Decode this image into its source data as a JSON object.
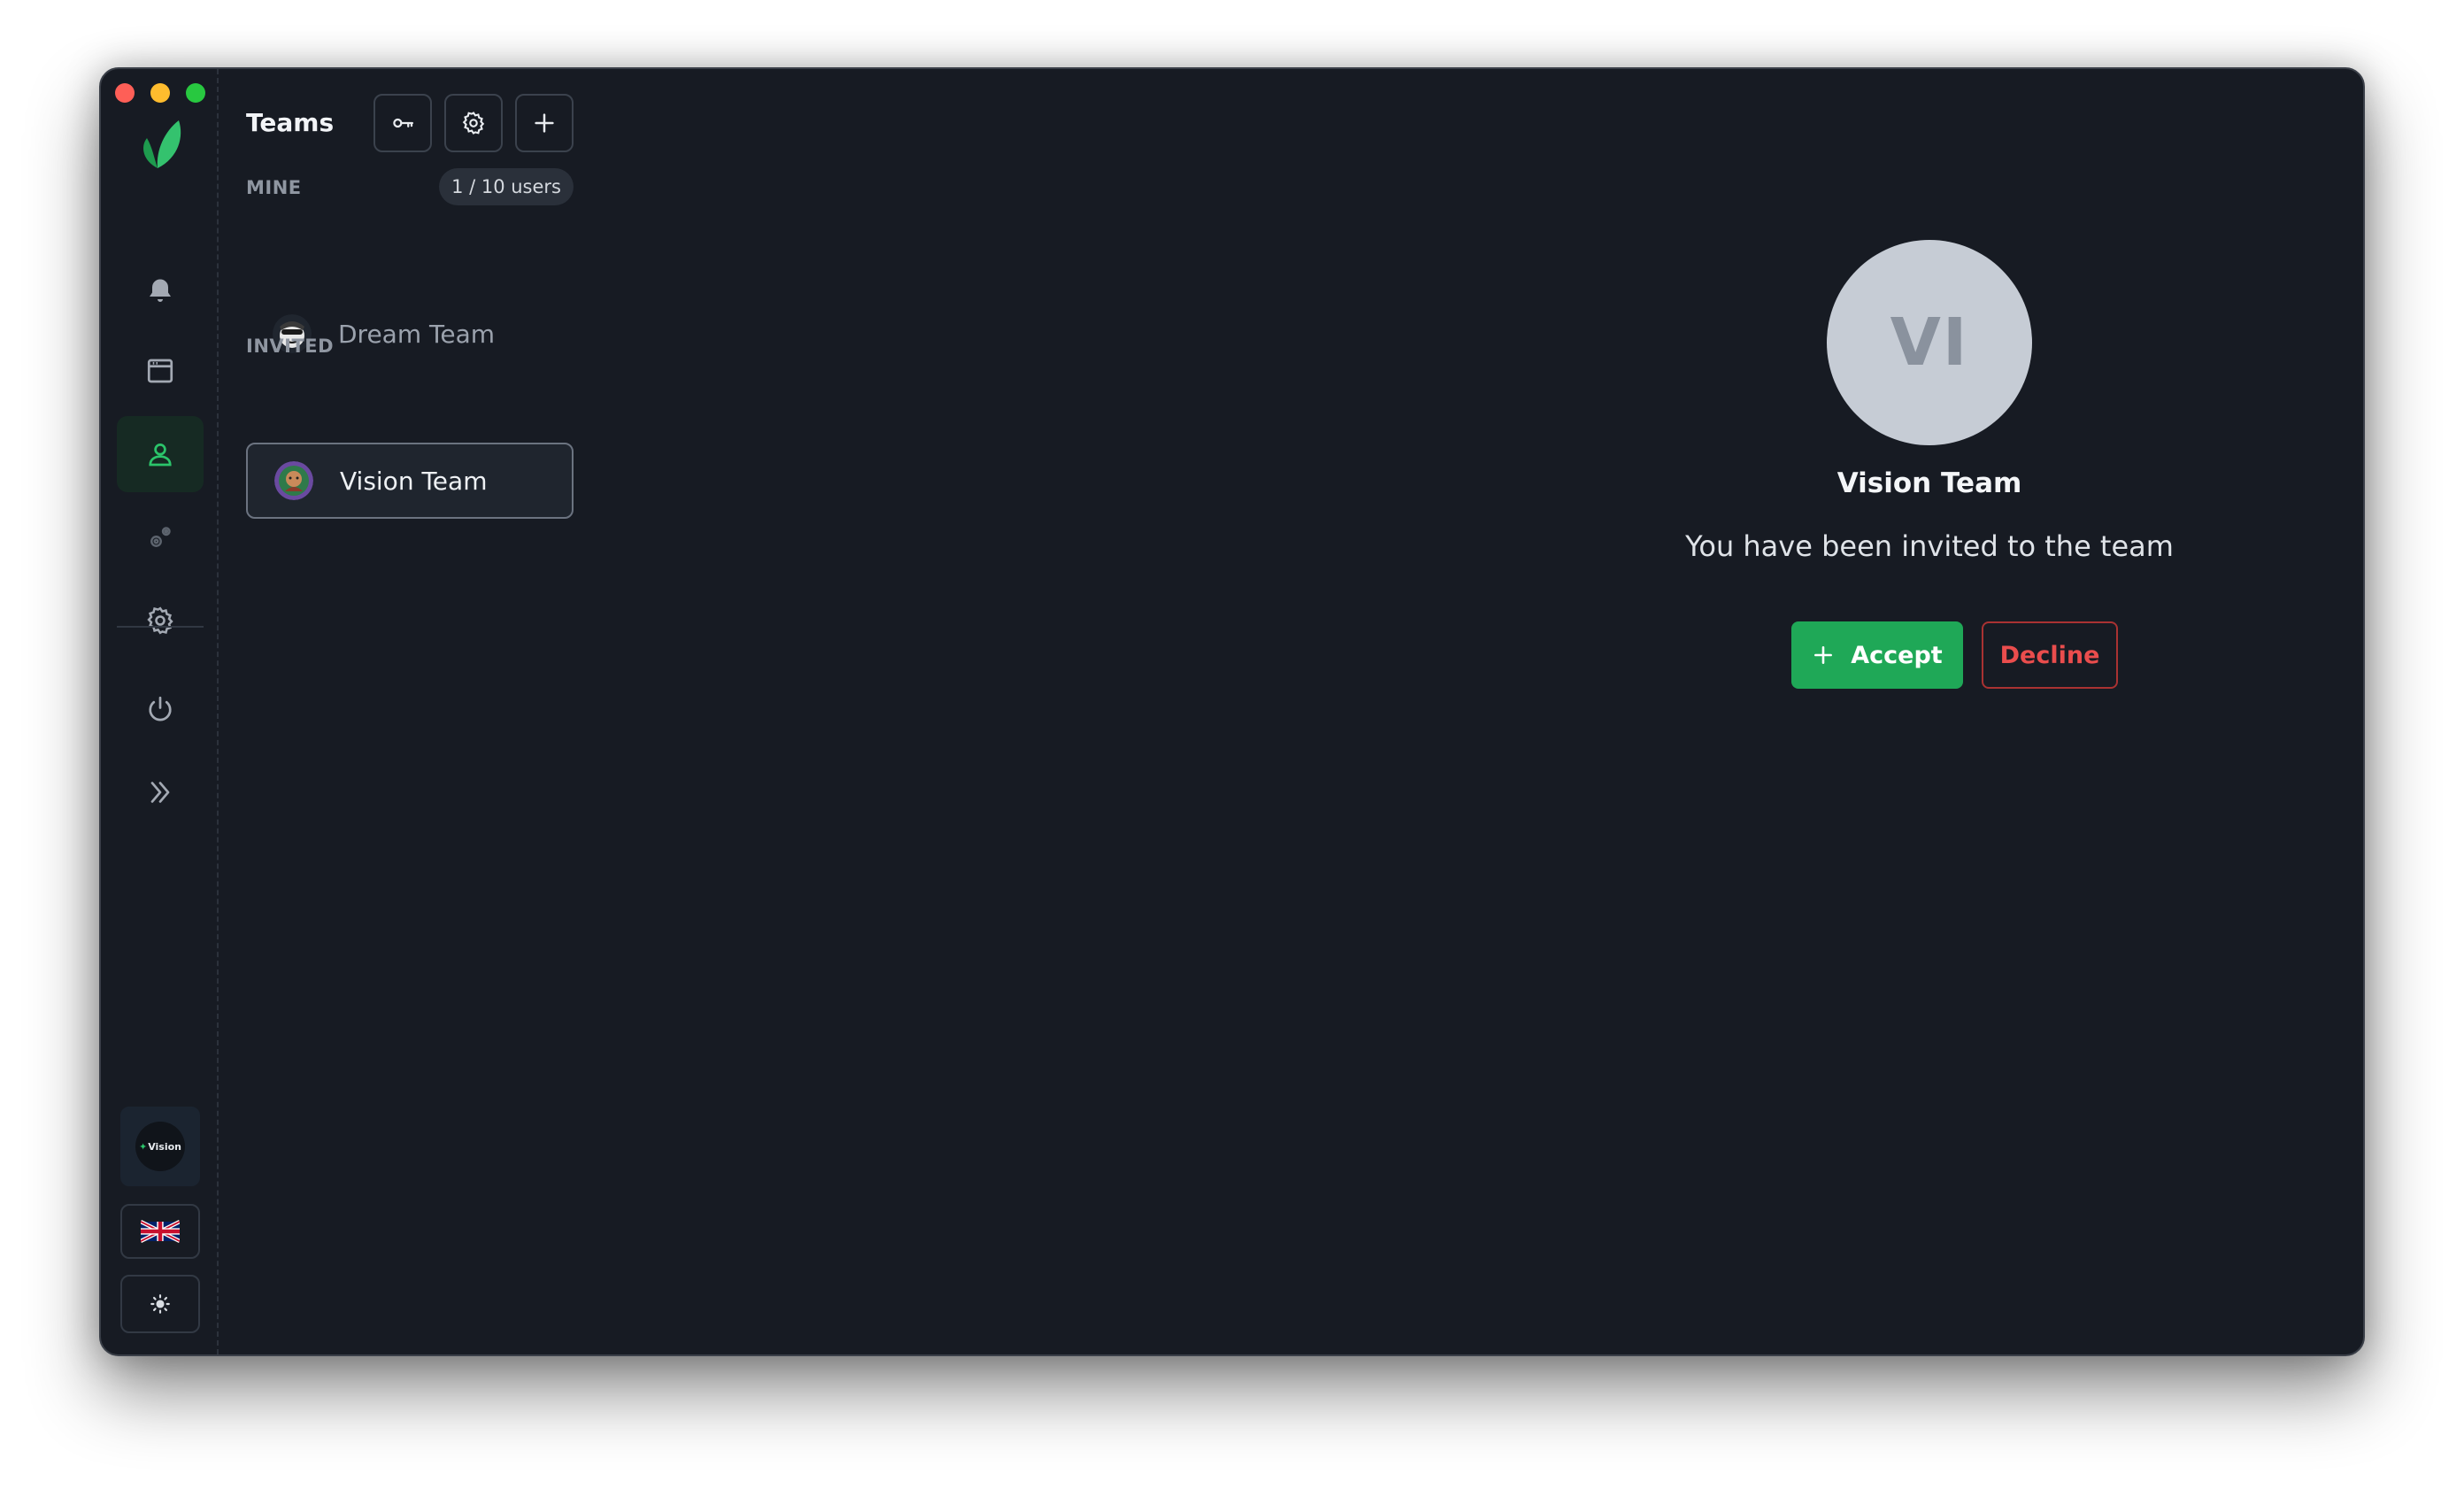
{
  "window": {
    "controls": [
      "close",
      "minimize",
      "maximize"
    ]
  },
  "rail": {
    "logo": "leaf-logo-icon",
    "items": [
      {
        "name": "notifications",
        "icon": "bell-icon",
        "active": false
      },
      {
        "name": "browser",
        "icon": "window-icon",
        "active": false
      },
      {
        "name": "teams",
        "icon": "user-icon",
        "active": true
      },
      {
        "name": "extensions",
        "icon": "cogs-icon",
        "active": false
      },
      {
        "name": "settings",
        "icon": "gear-icon",
        "active": false
      },
      {
        "name": "power",
        "icon": "power-icon",
        "active": false
      },
      {
        "name": "expand",
        "icon": "chevrons-right-icon",
        "active": false
      }
    ],
    "workspace_badge": "Vision",
    "language_flag": "uk-flag-icon",
    "theme_icon": "sun-icon"
  },
  "panel": {
    "title": "Teams",
    "tools": [
      "key-icon",
      "gear-icon",
      "plus-icon"
    ],
    "mine_label": "MINE",
    "users_count": "1 / 10 users",
    "invited_label": "INVITED",
    "mine_teams": [
      {
        "name": "Dream Team"
      }
    ],
    "invited_teams": [
      {
        "name": "Vision Team",
        "selected": true
      }
    ]
  },
  "invite": {
    "initials": "VI",
    "team_name": "Vision Team",
    "message": "You have been invited to the team",
    "accept_label": "Accept",
    "decline_label": "Decline"
  },
  "colors": {
    "background": "#171b23",
    "accent": "#1fa857",
    "danger": "#ea4d4d",
    "avatar_bg": "#c6ccd5"
  }
}
